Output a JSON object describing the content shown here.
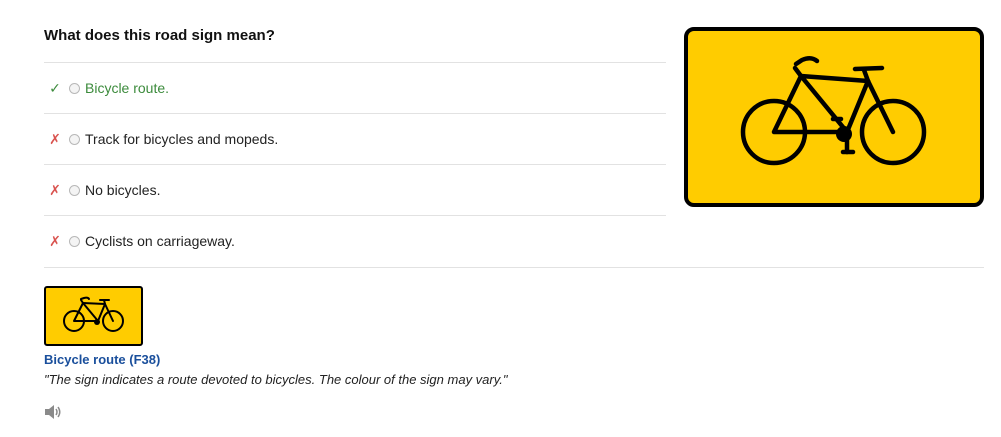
{
  "question": "What does this road sign mean?",
  "answers": [
    {
      "text": "Bicycle route.",
      "mark": "✓",
      "status": "correct"
    },
    {
      "text": "Track for bicycles and mopeds.",
      "mark": "✗",
      "status": "wrong"
    },
    {
      "text": "No bicycles.",
      "mark": "✗",
      "status": "wrong"
    },
    {
      "text": "Cyclists on carriageway.",
      "mark": "✗",
      "status": "wrong"
    }
  ],
  "sign": {
    "title": "Bicycle route (F38)",
    "description": "\"The sign indicates a route devoted to bicycles. The colour of the sign may vary.\"",
    "icon": "bicycle-icon",
    "background_color": "#ffcc00",
    "border_color": "#000000"
  },
  "audio": {
    "icon": "speaker-icon"
  },
  "colors": {
    "correct": "#3c8b3c",
    "wrong": "#d9534f",
    "link": "#1a4f9c"
  }
}
